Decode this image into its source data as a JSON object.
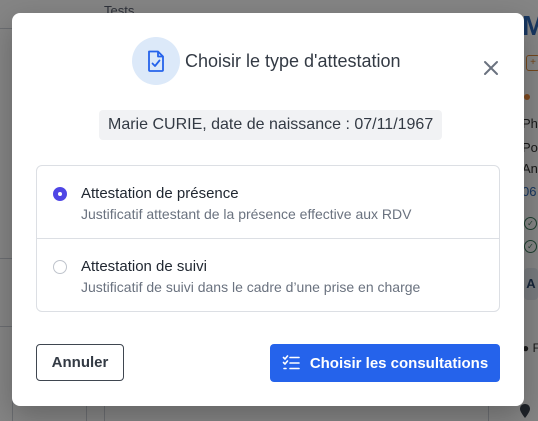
{
  "background": {
    "tab_label": "Tests",
    "right_title": "M",
    "right_snippets": [
      "Ph",
      "Po",
      "An",
      "06"
    ],
    "right_box_letter": "A",
    "right_row_letter": "F"
  },
  "modal": {
    "title": "Choisir le type d'attestation",
    "patient_label": "Marie CURIE, date de naissance : 07/11/1967",
    "options": [
      {
        "label": "Attestation de présence",
        "description": "Justificatif attestant de la présence effective aux RDV",
        "selected": true
      },
      {
        "label": "Attestation de suivi",
        "description": "Justificatif de suivi dans le cadre d’une prise en charge",
        "selected": false
      }
    ],
    "cancel_label": "Annuler",
    "confirm_label": "Choisir les consultations"
  },
  "colors": {
    "primary": "#2563eb",
    "radio_selected": "#4f46e5",
    "icon_bg": "#dce9f9",
    "icon": "#2563eb"
  },
  "icons": {
    "header": "document-check-icon",
    "close": "close-icon",
    "confirm": "list-icon"
  }
}
